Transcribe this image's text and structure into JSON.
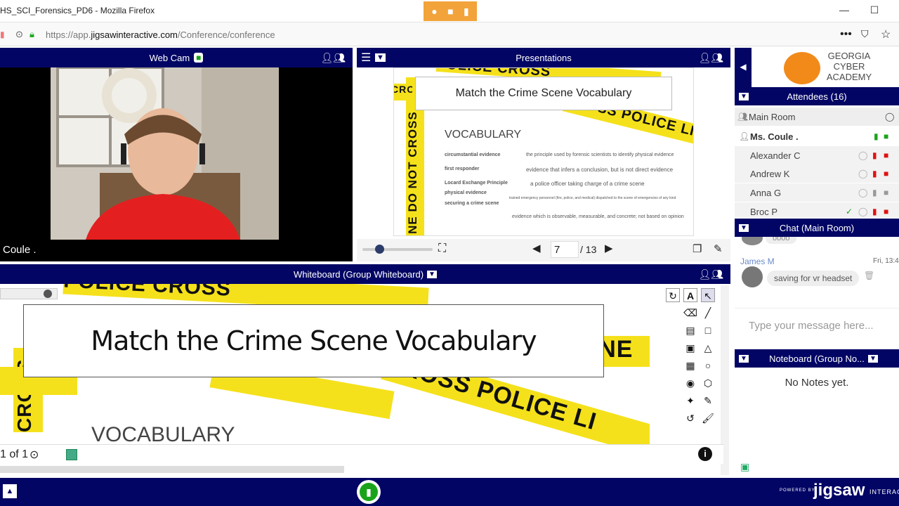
{
  "window": {
    "title": "HS_SCI_Forensics_PD6 - Mozilla Firefox",
    "min": "—",
    "max": "☐"
  },
  "browser": {
    "url_prefix": "https://app.",
    "url_domain": "jigsawinteractive.com",
    "url_path": "/Conference/conference"
  },
  "webcam": {
    "title": "Web Cam",
    "name_label": "Coule ."
  },
  "presentations": {
    "title": "Presentations",
    "slide_title": "Match the Crime Scene Vocabulary",
    "vocab_heading": "VOCABULARY",
    "terms": [
      "circumstantial evidence",
      "first responder",
      "Locard Exchange Principle",
      "physical evidence",
      "securing a crime scene"
    ],
    "definitions": [
      "the principle used by forensic scientists to identify physical evidence",
      "evidence that infers a conclusion, but is not direct evidence",
      "a police officer taking charge of a crime scene",
      "trained emergency personnel (fire, police, and medical) dispatched to the scene of emergencies of any kind",
      "evidence which is observable, measurable, and concrete; not based on opinion"
    ],
    "tape_texts": [
      "POLICE CROSS",
      "CROSS POLICE LINE",
      "LINE DO NOT CROSS",
      "CROSS"
    ],
    "current_page": "7",
    "total_pages": "/ 13"
  },
  "whiteboard": {
    "title": "Whiteboard (Group Whiteboard)",
    "slide_title": "Match the Crime Scene Vocabulary",
    "vocab_heading": "VOCABULARY",
    "tape_texts": [
      "POLICE CROSS",
      "LINE",
      "CROSS POLICE LI",
      "CROSS"
    ],
    "page_indicator": "1 of 1"
  },
  "sidebar": {
    "logo_text": [
      "GEORGIA",
      "CYBER",
      "ACADEMY"
    ],
    "attendees_title": "Attendees (16)",
    "main_room": "Main Room",
    "attendees": [
      {
        "name": "Ms. Coule .",
        "bold": true,
        "mic": "on",
        "cam": "on"
      },
      {
        "name": "Alexander C",
        "bold": false,
        "mic": "muted",
        "cam": "off"
      },
      {
        "name": "Andrew K",
        "bold": false,
        "mic": "muted",
        "cam": "off"
      },
      {
        "name": "Anna G",
        "bold": false,
        "mic": "none",
        "cam": "none"
      },
      {
        "name": "Broc P",
        "bold": false,
        "mic": "muted",
        "cam": "off"
      }
    ],
    "chat_title": "Chat (Main Room)",
    "chat": [
      {
        "sender": "",
        "text": "oooo",
        "time": ""
      },
      {
        "sender": "James M",
        "text": "saving for vr headset",
        "time": "Fri, 13:4"
      }
    ],
    "chat_placeholder": "Type your message here...",
    "notes_title": "Noteboard (Group No...",
    "notes_empty": "No Notes yet."
  },
  "footer": {
    "powered_by": "POWERED BY",
    "brand": "jigsaw",
    "brand_suffix": "INTERAC"
  },
  "colors": {
    "navy": "#020564",
    "tape_yellow": "#f5e11b",
    "mic_green": "#1aa31a",
    "muted_red": "#e01010",
    "orange": "#f2a33a"
  }
}
